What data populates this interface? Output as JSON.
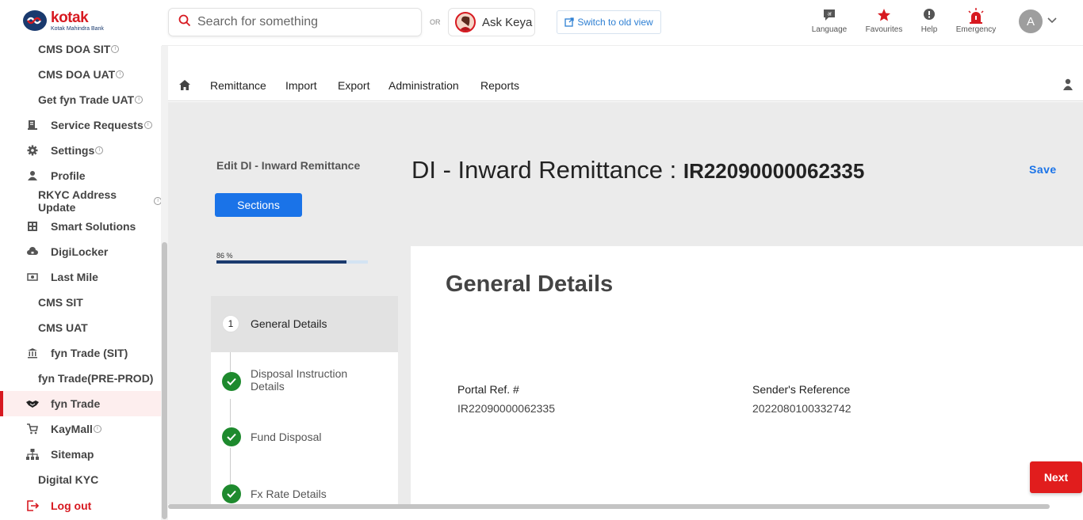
{
  "brand": {
    "name": "kotak",
    "sub": "Kotak Mahindra Bank"
  },
  "search": {
    "placeholder": "Search for something"
  },
  "or_label": "OR",
  "ask_keya": "Ask Keya",
  "switch_view": "Switch to old view",
  "header_tools": [
    {
      "label": "Language",
      "icon": "language-icon"
    },
    {
      "label": "Favourites",
      "icon": "star-icon"
    },
    {
      "label": "Help",
      "icon": "help-icon"
    },
    {
      "label": "Emergency",
      "icon": "siren-icon"
    }
  ],
  "user_initial": "A",
  "sidebar": {
    "items": [
      {
        "label": "CMS DOA SIT",
        "icon": null,
        "info": true
      },
      {
        "label": "CMS DOA UAT",
        "icon": null,
        "info": true
      },
      {
        "label": "Get fyn Trade UAT",
        "icon": null,
        "info": true
      },
      {
        "label": "Service Requests",
        "icon": "service-requests-icon",
        "info": true
      },
      {
        "label": "Settings",
        "icon": "gear-icon",
        "info": true
      },
      {
        "label": "Profile",
        "icon": "person-icon",
        "info": false
      },
      {
        "label": "RKYC Address Update",
        "icon": null,
        "info": true
      },
      {
        "label": "Smart Solutions",
        "icon": "smart-solutions-icon",
        "info": false
      },
      {
        "label": "DigiLocker",
        "icon": "cloud-lock-icon",
        "info": false
      },
      {
        "label": "Last Mile",
        "icon": "cash-icon",
        "info": false
      },
      {
        "label": "CMS SIT",
        "icon": null,
        "info": false
      },
      {
        "label": "CMS UAT",
        "icon": null,
        "info": false
      },
      {
        "label": "fyn Trade (SIT)",
        "icon": "bank-icon",
        "info": false
      },
      {
        "label": "fyn Trade(PRE-PROD)",
        "icon": null,
        "info": false
      },
      {
        "label": "fyn Trade",
        "icon": "handshake-icon",
        "info": false,
        "active": true
      },
      {
        "label": "KayMall",
        "icon": "cart-icon",
        "info": true
      },
      {
        "label": "Sitemap",
        "icon": "sitemap-icon",
        "info": false
      },
      {
        "label": "Digital KYC",
        "icon": null,
        "info": false
      },
      {
        "label": "Log out",
        "icon": "logout-icon",
        "info": false
      }
    ]
  },
  "nav": {
    "items": [
      "Remittance",
      "Import",
      "Export",
      "Administration",
      "Reports"
    ]
  },
  "page": {
    "edit_label": "Edit DI - Inward Remittance",
    "sections_button": "Sections",
    "progress_label": "86 %",
    "progress_value": 0.86,
    "title": "DI - Inward Remittance :",
    "reference": "IR22090000062335",
    "save": "Save"
  },
  "steps": [
    {
      "num": "1",
      "label": "General Details",
      "state": "current"
    },
    {
      "label": "Disposal Instruction Details",
      "state": "done"
    },
    {
      "label": "Fund Disposal",
      "state": "done"
    },
    {
      "label": "Fx Rate Details",
      "state": "done"
    }
  ],
  "panel": {
    "title": "General Details",
    "fields": [
      {
        "label": "Portal Ref. #",
        "value": "IR22090000062335"
      },
      {
        "label": "Sender's Reference",
        "value": "2022080100332742"
      }
    ]
  },
  "next_button": "Next",
  "colors": {
    "brand_red": "#d71920",
    "primary_blue": "#1a73e8",
    "success_green": "#1e8a2e",
    "navy": "#1a3a6e"
  }
}
